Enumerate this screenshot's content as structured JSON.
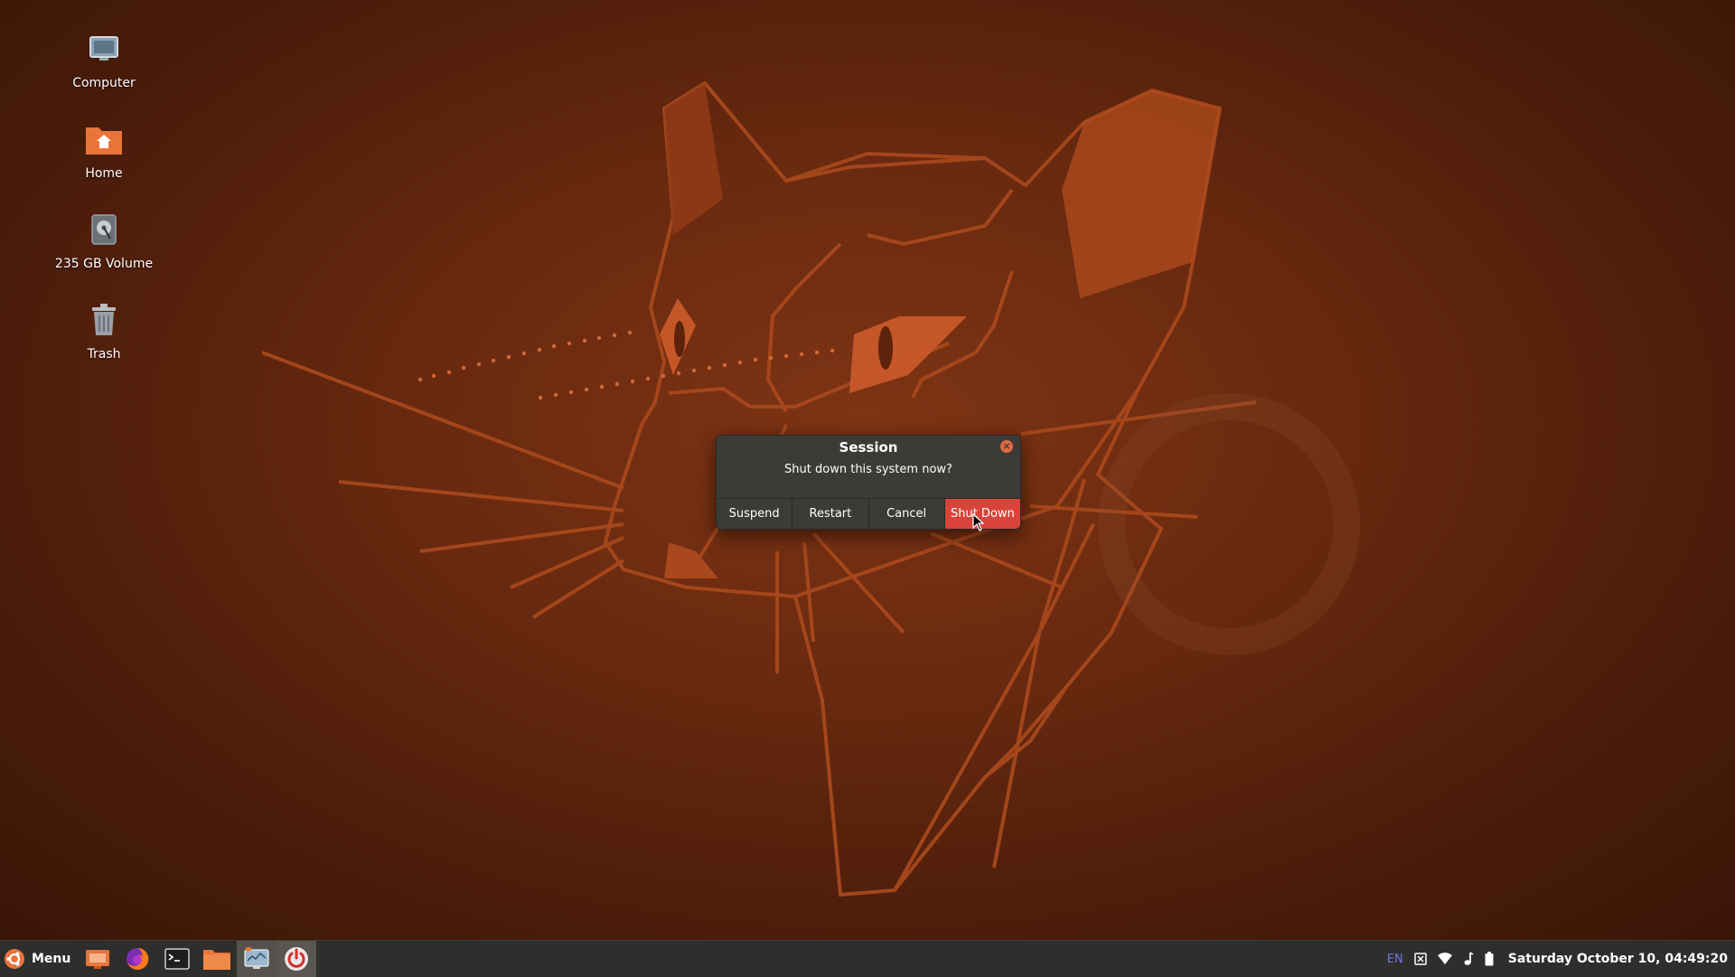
{
  "desktop": {
    "icons": [
      {
        "label": "Computer",
        "icon": "computer-icon"
      },
      {
        "label": "Home",
        "icon": "home-folder-icon"
      },
      {
        "label": "235 GB Volume",
        "icon": "drive-icon"
      },
      {
        "label": "Trash",
        "icon": "trash-icon"
      }
    ]
  },
  "dialog": {
    "title": "Session",
    "message": "Shut down this system now?",
    "buttons": {
      "suspend": "Suspend",
      "restart": "Restart",
      "cancel": "Cancel",
      "shutdown": "Shut Down"
    }
  },
  "taskbar": {
    "menu_label": "Menu",
    "launchers": [
      "desktop-icon",
      "firefox-icon",
      "terminal-icon",
      "files-icon",
      "system-monitor-icon",
      "power-icon"
    ],
    "tray": {
      "language": "EN",
      "clock": "Saturday October 10, 04:49:20"
    }
  },
  "colors": {
    "wallpaper": "#6a2a10",
    "accent": "#e9743a",
    "shutdown_button": "#d9443a",
    "dialog_bg": "#3c3b37",
    "taskbar_bg": "#2e2e2c"
  }
}
